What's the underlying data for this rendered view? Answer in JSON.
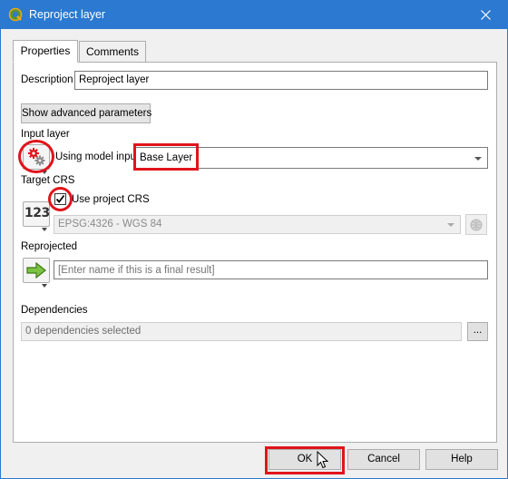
{
  "window": {
    "title": "Reproject layer",
    "close_icon": "close-icon",
    "app_icon": "qgis-logo-icon",
    "accent": "#2b79d0"
  },
  "tabs": [
    {
      "label": "Properties",
      "active": true
    },
    {
      "label": "Comments",
      "active": false
    }
  ],
  "description": {
    "label": "Description",
    "value": "Reproject layer"
  },
  "advanced_button": "Show advanced parameters",
  "input_layer": {
    "label": "Input layer",
    "source_icon": "model-input-gears-icon",
    "using_text": "Using model input",
    "selected": "Base Layer"
  },
  "target_crs": {
    "label": "Target CRS",
    "type_icon": "static-value-123-icon",
    "checkbox_label": "Use project CRS",
    "checked": true,
    "crs_value": "EPSG:4326 - WGS 84",
    "crs_button_icon": "crs-selector-globe-icon"
  },
  "reprojected": {
    "label": "Reprojected",
    "icon": "output-arrow-icon",
    "placeholder": "[Enter name if this is a final result]"
  },
  "dependencies": {
    "label": "Dependencies",
    "value": "0 dependencies selected",
    "browse_label": "..."
  },
  "footer": {
    "ok": "OK",
    "cancel": "Cancel",
    "help": "Help"
  },
  "highlight_color": "#e0141b"
}
